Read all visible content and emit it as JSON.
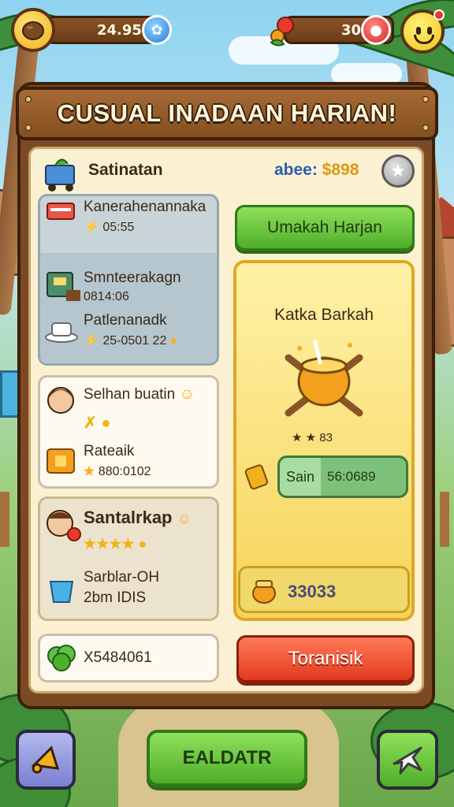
{
  "hud": {
    "coins": "24.950",
    "hearts": "30",
    "coin_icon": "coconut-icon",
    "gem_icon": "blue-gem-icon",
    "heart_icon": "red-berry-icon",
    "profile_icon": "smiley-face-icon"
  },
  "panel": {
    "title": "CUSUAL INADAAN HARIAN!",
    "shop_title": "Satinatan",
    "balance_label": "abee:",
    "balance_value": "$898"
  },
  "left_items": [
    {
      "name": "Kanerahenannaka",
      "price": "05:55"
    },
    {
      "name": "Smnteerakagn",
      "price": "0814:06"
    },
    {
      "name": "Patlenanadk",
      "price": "25-0501 22"
    },
    {
      "name": "Selhan buatin",
      "price": ""
    },
    {
      "name": "Rateaik",
      "price": "880:0102"
    },
    {
      "name": "Santalrkap",
      "price": ""
    },
    {
      "name": "Sarblar-OH",
      "price": "2bm IDIS"
    },
    {
      "name": "",
      "price": "X5484061"
    }
  ],
  "right": {
    "green_button": "Umakah Harjan",
    "feature_title": "Katka Barkah",
    "feature_rating": "★ ★ 83",
    "timer_label": "Sain",
    "timer_value": "56:0689",
    "feature_price": "33033",
    "red_button": "Toranisik"
  },
  "bottom": {
    "mid_button": "EALDATR",
    "left_icon": "megaphone-icon",
    "right_icon": "airplane-icon"
  },
  "colors": {
    "wood": "#7b4a24",
    "parchment": "#fbf1d2",
    "green": "#4fae2a",
    "red": "#e23a1e",
    "gold": "#f6d45a"
  }
}
